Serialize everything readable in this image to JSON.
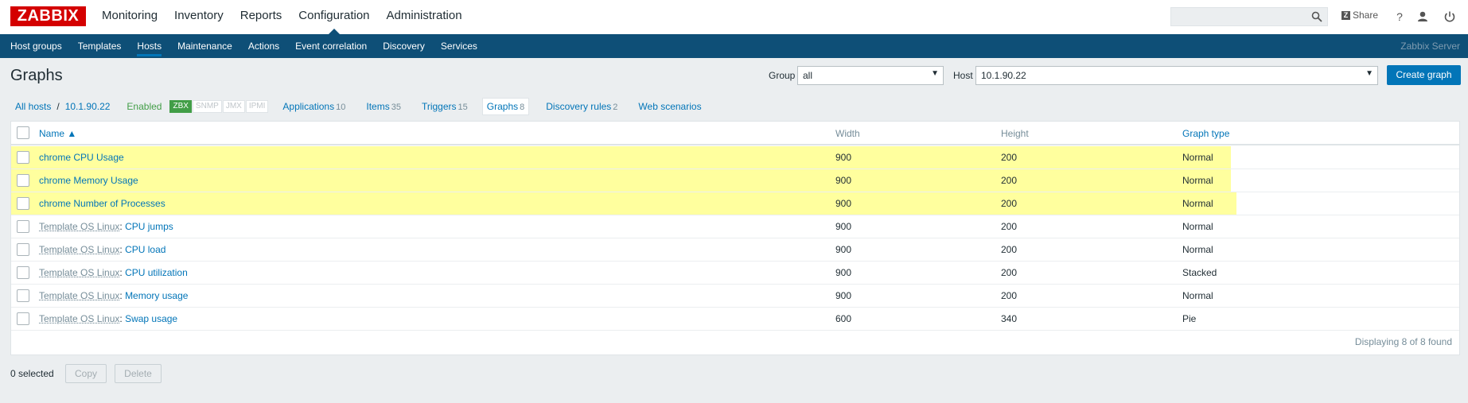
{
  "brand": {
    "logo_text": "ZABBIX",
    "accent": "#d40000",
    "nav_bg": "#0e4f77",
    "link": "#0275b8"
  },
  "topnav": [
    {
      "label": "Monitoring"
    },
    {
      "label": "Inventory"
    },
    {
      "label": "Reports"
    },
    {
      "label": "Configuration"
    },
    {
      "label": "Administration"
    }
  ],
  "header": {
    "share_label": "Share",
    "help_label": "?"
  },
  "subnav": {
    "items": [
      {
        "label": "Host groups"
      },
      {
        "label": "Templates"
      },
      {
        "label": "Hosts"
      },
      {
        "label": "Maintenance"
      },
      {
        "label": "Actions"
      },
      {
        "label": "Event correlation"
      },
      {
        "label": "Discovery"
      },
      {
        "label": "Services"
      }
    ],
    "server_name": "Zabbix Server"
  },
  "page": {
    "title": "Graphs",
    "group_label": "Group",
    "group_value": "all",
    "host_label": "Host",
    "host_value": "10.1.90.22",
    "create_label": "Create graph"
  },
  "breadcrumb": {
    "all_hosts": "All hosts",
    "separator": "/",
    "host": "10.1.90.22",
    "status": "Enabled",
    "availability": [
      "ZBX",
      "SNMP",
      "JMX",
      "IPMI"
    ]
  },
  "tabs": [
    {
      "label": "Applications",
      "count": "10"
    },
    {
      "label": "Items",
      "count": "35"
    },
    {
      "label": "Triggers",
      "count": "15"
    },
    {
      "label": "Graphs",
      "count": "8"
    },
    {
      "label": "Discovery rules",
      "count": "2"
    },
    {
      "label": "Web scenarios",
      "count": ""
    }
  ],
  "table": {
    "columns": {
      "name": "Name ▲",
      "width": "Width",
      "height": "Height",
      "graph_type": "Graph type"
    },
    "rows": [
      {
        "template": "",
        "name": "chrome CPU Usage",
        "width": "900",
        "height": "200",
        "type": "Normal"
      },
      {
        "template": "",
        "name": "chrome Memory Usage",
        "width": "900",
        "height": "200",
        "type": "Normal"
      },
      {
        "template": "",
        "name": "chrome Number of Processes",
        "width": "900",
        "height": "200",
        "type": "Normal"
      },
      {
        "template": "Template OS Linux",
        "name": "CPU jumps",
        "width": "900",
        "height": "200",
        "type": "Normal"
      },
      {
        "template": "Template OS Linux",
        "name": "CPU load",
        "width": "900",
        "height": "200",
        "type": "Normal"
      },
      {
        "template": "Template OS Linux",
        "name": "CPU utilization",
        "width": "900",
        "height": "200",
        "type": "Stacked"
      },
      {
        "template": "Template OS Linux",
        "name": "Memory usage",
        "width": "900",
        "height": "200",
        "type": "Normal"
      },
      {
        "template": "Template OS Linux",
        "name": "Swap usage",
        "width": "600",
        "height": "340",
        "type": "Pie"
      }
    ],
    "footer": "Displaying 8 of 8 found"
  },
  "actions": {
    "selected": "0 selected",
    "copy": "Copy",
    "delete": "Delete"
  }
}
